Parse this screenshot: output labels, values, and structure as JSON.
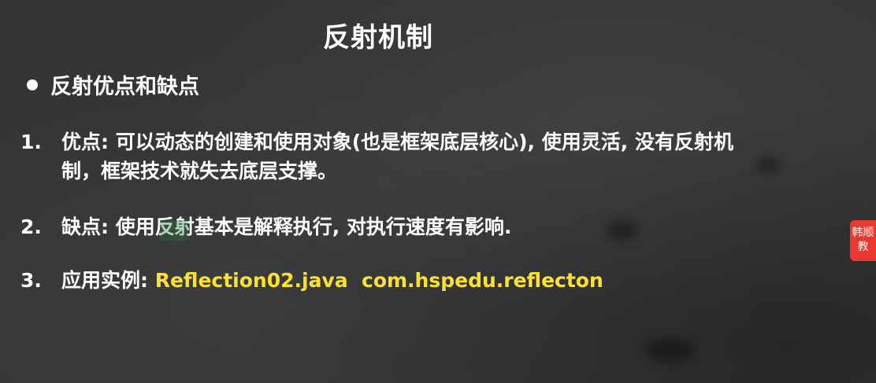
{
  "slide": {
    "title": "反射机制",
    "section_heading": "反射优点和缺点",
    "items": [
      {
        "number": "1.",
        "text_line1": "优点: 可以动态的创建和使用对象(也是框架底层核心), 使用灵活, 没有反射机",
        "text_line2": "制，框架技术就失去底层支撑。"
      },
      {
        "number": "2.",
        "text": "缺点: 使用反射基本是解释执行, 对执行速度有影响."
      },
      {
        "number": "3.",
        "label": "应用实例: ",
        "highlight": "Reflection02.java  com.hspedu.reflecton"
      }
    ],
    "badge": {
      "line1": "韩顺",
      "line2": "教"
    }
  },
  "colors": {
    "background": "#333436",
    "text": "#ffffff",
    "highlight": "#fde12c",
    "badge": "#e8382f"
  }
}
